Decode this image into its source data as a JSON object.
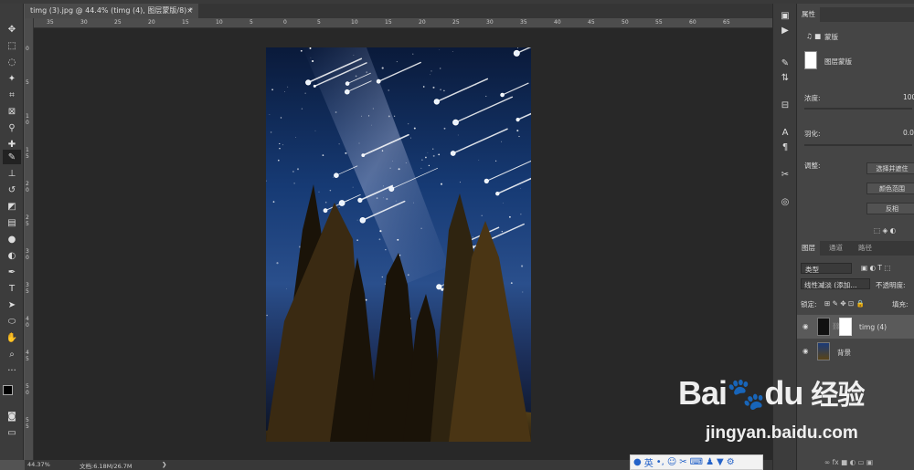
{
  "document": {
    "tab_title": "timg (3).jpg @ 44.4% (timg (4), 图层蒙版/8) *",
    "close_glyph": "×"
  },
  "ruler": {
    "h_ticks": [
      "35",
      "30",
      "25",
      "20",
      "15",
      "10",
      "5",
      "0",
      "5",
      "10",
      "15",
      "20",
      "25",
      "30",
      "35",
      "40",
      "45",
      "50",
      "55",
      "60",
      "65"
    ],
    "v_ticks": [
      "0",
      "5",
      "1 0",
      "1 5",
      "2 0",
      "2 5",
      "3 0",
      "3 5",
      "4 0",
      "4 5",
      "5 0",
      "5 5"
    ]
  },
  "status": {
    "zoom": "44.37%",
    "doc_size": "文档:6.18M/26.7M"
  },
  "properties": {
    "tab": "属性",
    "mask_label": "蒙版",
    "layer_mask_label": "图层蒙版",
    "density_label": "浓度:",
    "density_value": "100",
    "feather_label": "羽化:",
    "feather_value": "0.0",
    "adjust_label": "调整:",
    "btn_select_mask": "选择并遮住",
    "btn_color_range": "颜色范围",
    "btn_invert": "反相"
  },
  "layers_panel": {
    "tabs": [
      "图层",
      "通道",
      "路径"
    ],
    "filter_label": "类型",
    "blend_mode": "线性减淡 (添加...",
    "opacity_label": "不透明度:",
    "lock_label": "锁定:",
    "fill_label": "填充:",
    "layers": [
      {
        "name": "timg (4)",
        "selected": true
      },
      {
        "name": "背景",
        "selected": false
      }
    ]
  },
  "watermark": {
    "brand": "Bai",
    "brand2": "du",
    "cn": "经验",
    "url": "jingyan.baidu.com"
  },
  "ime": {
    "lang": "英"
  },
  "colors": {
    "accent": "#2563c9",
    "panel_bg": "#454545",
    "canvas_bg": "#282828"
  }
}
